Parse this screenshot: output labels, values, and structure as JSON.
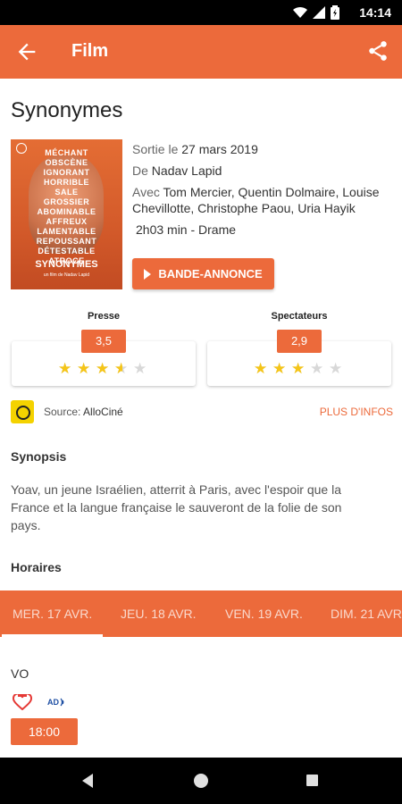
{
  "status_bar": {
    "time": "14:14"
  },
  "app_bar": {
    "title": "Film"
  },
  "movie": {
    "title": "Synonymes",
    "release_prefix": "Sortie le",
    "release_date": "27 mars 2019",
    "director_prefix": "De",
    "director": "Nadav Lapid",
    "cast_prefix": "Avec",
    "cast": "Tom Mercier, Quentin Dolmaire, Louise Chevillotte, Christophe Paou, Uria Hayik",
    "duration_genre": "2h03 min - Drame",
    "trailer_label": "BANDE-ANNONCE",
    "poster": {
      "words": [
        "MÉCHANT",
        "OBSCÈNE",
        "IGNORANT",
        "HORRIBLE",
        "SALE",
        "GROSSIER",
        "ABOMINABLE",
        "AFFREUX",
        "LAMENTABLE",
        "REPOUSSANT",
        "DÉTESTABLE",
        "ATROCE"
      ],
      "title": "SYNONYMES",
      "director": "un film de Nadav Lapid"
    }
  },
  "ratings": [
    {
      "label": "Presse",
      "score": "3,5",
      "value": 3.5,
      "max": 5
    },
    {
      "label": "Spectateurs",
      "score": "2,9",
      "value": 2.9,
      "max": 5
    }
  ],
  "source": {
    "prefix": "Source:",
    "name": "AlloCiné",
    "more_label": "PLUS D'INFOS"
  },
  "synopsis": {
    "heading": "Synopsis",
    "text": "Yoav, un jeune Israélien, atterrit à Paris, avec l'espoir que la France et la langue française le sauveront de la folie de son pays."
  },
  "showtimes": {
    "heading": "Horaires",
    "days": [
      {
        "label": "MER. 17 AVR.",
        "active": true
      },
      {
        "label": "JEU. 18 AVR.",
        "active": false
      },
      {
        "label": "VEN. 19 AVR.",
        "active": false
      },
      {
        "label": "DIM. 21 AVR.",
        "active": false
      }
    ],
    "version": "VO",
    "formats": [
      {
        "name": "accessibility-heart-icon",
        "color": "#e53935"
      },
      {
        "name": "audio-description-icon",
        "color": "#1e4fa3",
        "text": "AD"
      }
    ],
    "times": [
      "18:00"
    ]
  },
  "colors": {
    "accent": "#ec6a3b",
    "star": "#f5c518",
    "star_empty": "#d8d8d8"
  }
}
